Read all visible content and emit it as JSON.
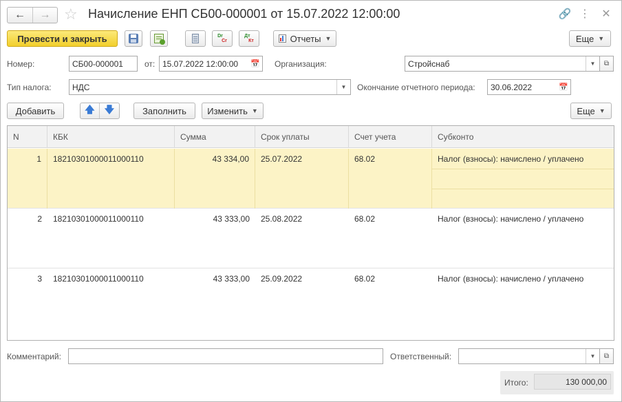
{
  "window": {
    "title": "Начисление ЕНП СБ00-000001 от 15.07.2022 12:00:00",
    "icons": [
      "back-arrow-icon",
      "forward-arrow-icon",
      "star-icon",
      "link-icon",
      "more-vertical-icon",
      "close-icon"
    ]
  },
  "toolbar": {
    "post_close_label": "Провести и закрыть",
    "reports_label": "Отчеты",
    "more_label": "Еще"
  },
  "form": {
    "number_label": "Номер:",
    "number_value": "СБ00-000001",
    "date_label": "от:",
    "date_value": "15.07.2022 12:00:00",
    "org_label": "Организация:",
    "org_value": "Стройснаб",
    "tax_type_label": "Тип налога:",
    "tax_type_value": "НДС",
    "period_end_label": "Окончание отчетного периода:",
    "period_end_value": "30.06.2022"
  },
  "table_toolbar": {
    "add_label": "Добавить",
    "fill_label": "Заполнить",
    "change_label": "Изменить",
    "more_label": "Еще"
  },
  "table": {
    "columns": [
      "N",
      "КБК",
      "Сумма",
      "Срок уплаты",
      "Счет учета",
      "Субконто"
    ],
    "rows": [
      {
        "n": "1",
        "kbk": "18210301000011000110",
        "sum": "43 334,00",
        "due": "25.07.2022",
        "account": "68.02",
        "subconto": "Налог (взносы): начислено / уплачено"
      },
      {
        "n": "2",
        "kbk": "18210301000011000110",
        "sum": "43 333,00",
        "due": "25.08.2022",
        "account": "68.02",
        "subconto": "Налог (взносы): начислено / уплачено"
      },
      {
        "n": "3",
        "kbk": "18210301000011000110",
        "sum": "43 333,00",
        "due": "25.09.2022",
        "account": "68.02",
        "subconto": "Налог (взносы): начислено / уплачено"
      }
    ]
  },
  "footer": {
    "comment_label": "Комментарий:",
    "comment_value": "",
    "responsible_label": "Ответственный:",
    "responsible_value": "",
    "total_label": "Итого:",
    "total_value": "130 000,00"
  }
}
